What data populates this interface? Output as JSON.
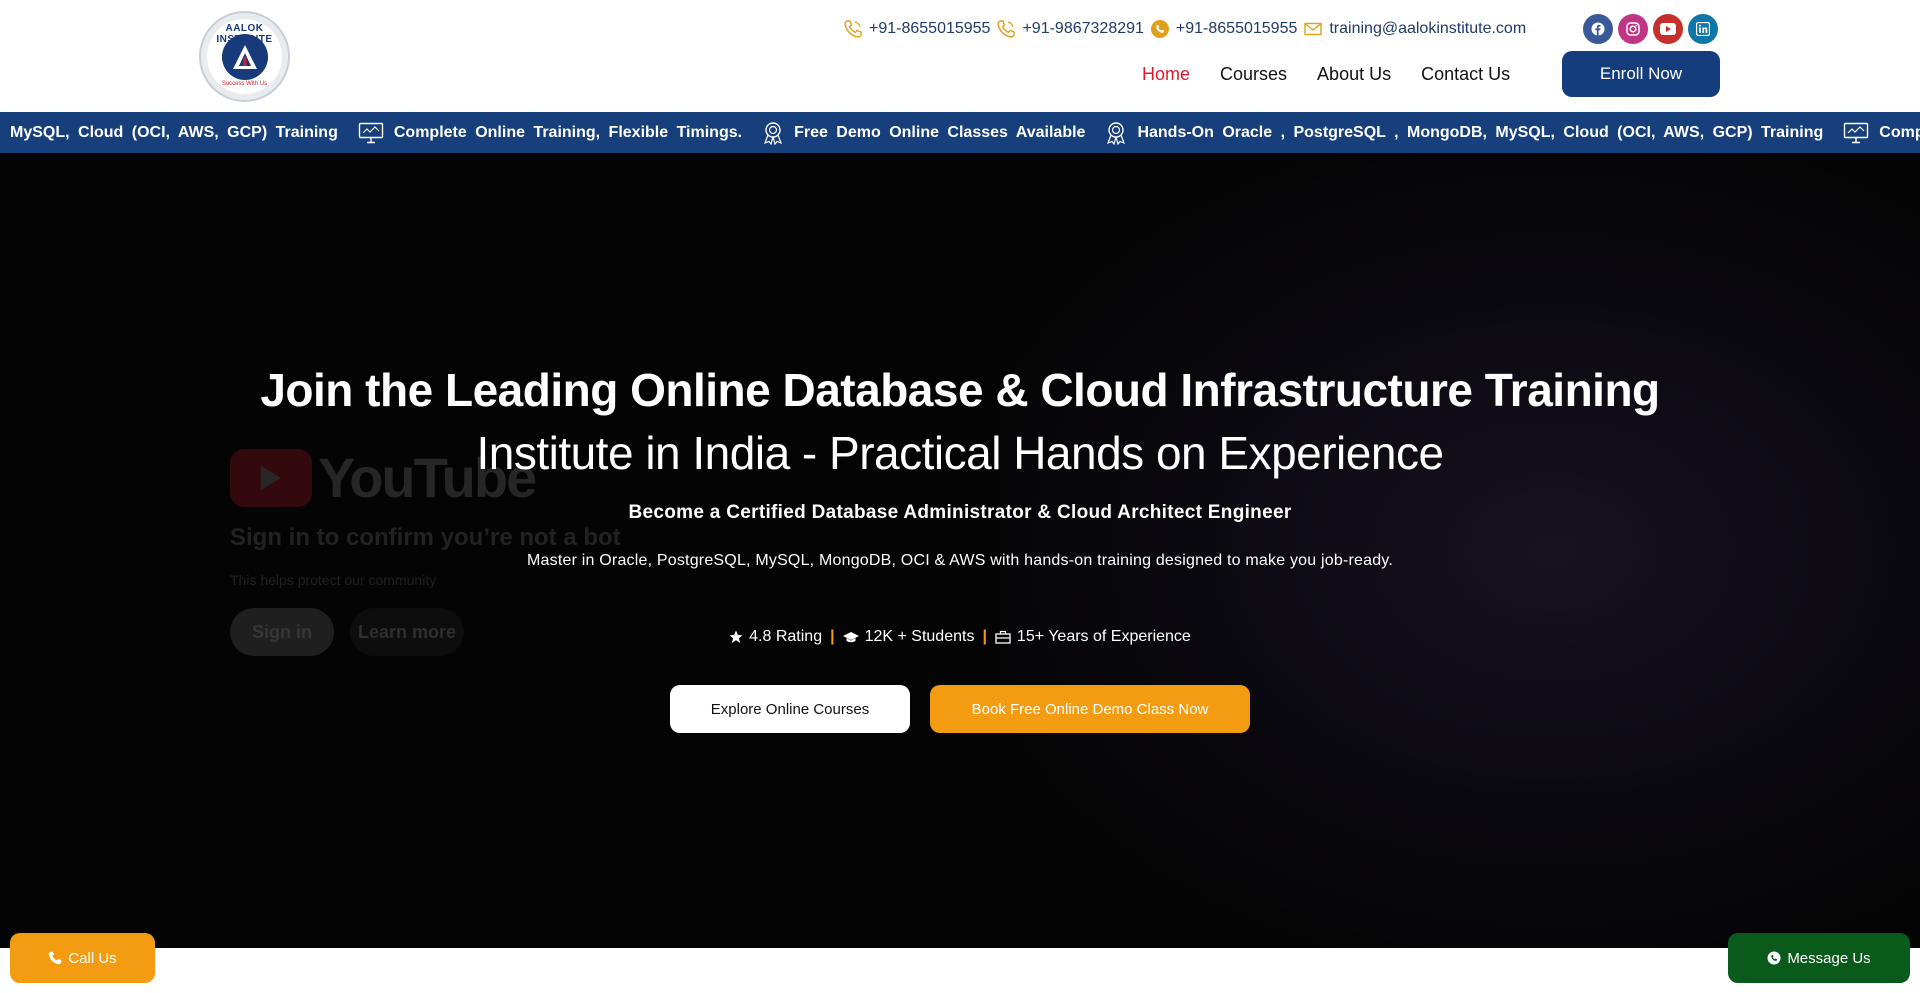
{
  "brand": {
    "logo_text": "AALOK INSTITUTE",
    "logo_tagline": "Success With Us"
  },
  "contact": {
    "phone1": "+91-8655015955",
    "phone2": "+91-9867328291",
    "whatsapp": "+91-8655015955",
    "email": "training@aalokinstitute.com"
  },
  "socials": [
    "facebook-icon",
    "instagram-icon",
    "youtube-icon",
    "linkedin-icon"
  ],
  "nav": {
    "items": [
      "Home",
      "Courses",
      "About Us",
      "Contact Us"
    ],
    "active": "Home",
    "cta": "Enroll Now"
  },
  "ticker": {
    "items": [
      "MySQL, Cloud (OCI, AWS, GCP) Training",
      "Complete Online Training, Flexible Timings.",
      "Free Demo Online Classes Available",
      "Hands-On Oracle , PostgreSQL , MongoDB, MySQL, Cloud (OCI, AWS, GCP) Training",
      "Comp"
    ]
  },
  "video_overlay": {
    "brand": "YouTube",
    "message": "Sign in to confirm you’re not a bot",
    "sub": "This helps protect our community",
    "sign_in": "Sign in",
    "learn_more": "Learn more"
  },
  "hero": {
    "title_line1": "Join the Leading Online Database & Cloud Infrastructure Training",
    "title_line2": "Institute in India  - Practical Hands on Experience",
    "subtitle": "Become a Certified Database Administrator & Cloud Architect Engineer",
    "description": "Master in Oracle, PostgreSQL, MySQL, MongoDB, OCI & AWS with hands-on training designed to make you job-ready.",
    "stats": {
      "rating": "4.8 Rating",
      "students": "12K + Students",
      "experience": "15+ Years of Experience",
      "separator": "|"
    },
    "btn_explore": "Explore Online Courses",
    "btn_demo": "Book Free Online Demo Class Now"
  },
  "floating": {
    "call": "Call Us",
    "message": "Message Us"
  },
  "colors": {
    "primary": "#173f7b",
    "accent": "#f39c12",
    "active_nav": "#e0182d",
    "whatsapp_green": "#0a5a1c"
  }
}
